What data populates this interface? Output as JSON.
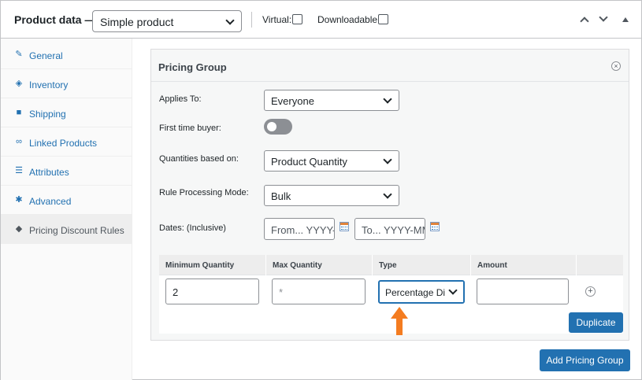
{
  "header": {
    "title": "Product data —",
    "product_type": "Simple product",
    "virtual_label": "Virtual:",
    "downloadable_label": "Downloadable:"
  },
  "sidebar": {
    "items": [
      {
        "label": "General",
        "icon": "wrench-icon"
      },
      {
        "label": "Inventory",
        "icon": "tag-icon"
      },
      {
        "label": "Shipping",
        "icon": "truck-icon"
      },
      {
        "label": "Linked Products",
        "icon": "link-icon"
      },
      {
        "label": "Attributes",
        "icon": "list-icon"
      },
      {
        "label": "Advanced",
        "icon": "gear-icon"
      },
      {
        "label": "Pricing Discount Rules",
        "icon": "pricetag-icon",
        "active": true
      }
    ]
  },
  "group": {
    "title": "Pricing Group",
    "applies_to_label": "Applies To:",
    "applies_to_value": "Everyone",
    "first_time_label": "First time buyer:",
    "quantities_label": "Quantities based on:",
    "quantities_value": "Product Quantity",
    "mode_label": "Rule Processing Mode:",
    "mode_value": "Bulk",
    "dates_label": "Dates: (Inclusive)",
    "date_from_placeholder": "From... YYYY-",
    "date_to_placeholder": "To... YYYY-MM"
  },
  "rules_table": {
    "headers": [
      "Minimum Quantity",
      "Max Quantity",
      "Type",
      "Amount"
    ],
    "row": {
      "min_qty": "2",
      "max_qty": "*",
      "type": "Percentage Di",
      "amount": ""
    },
    "duplicate_label": "Duplicate"
  },
  "add_group_label": "Add Pricing Group",
  "colors": {
    "accent": "#2271b1",
    "highlight_arrow": "#f47c20"
  }
}
